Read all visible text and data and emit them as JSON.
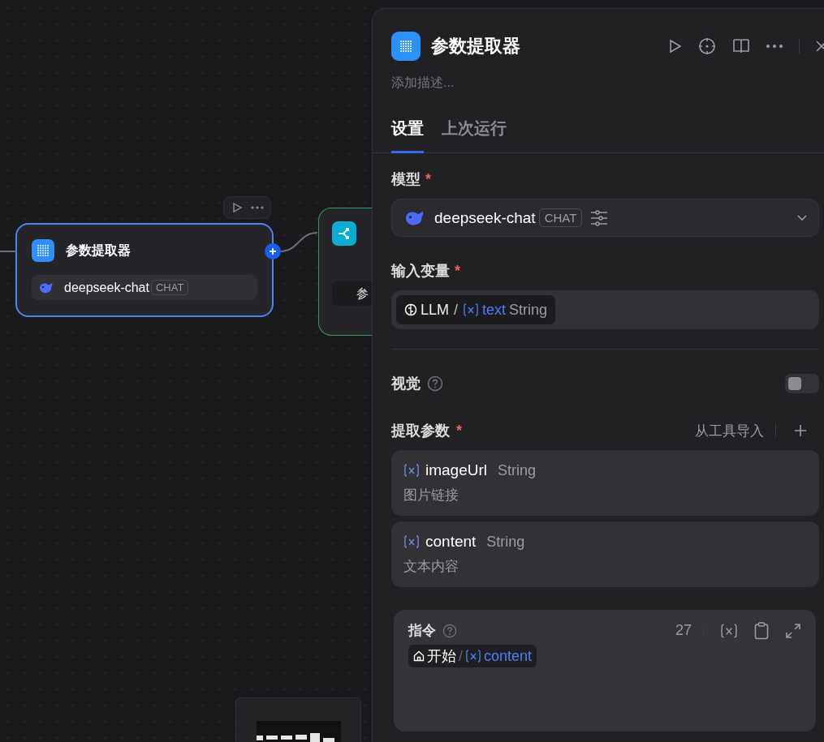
{
  "canvas": {
    "nodes": [
      {
        "kind": "extractor",
        "title": "参数提取器",
        "selected": true,
        "model": "deepseek-chat",
        "model_tag": "CHAT"
      },
      {
        "kind": "branch",
        "chip": "参",
        "selected": false
      }
    ]
  },
  "panel": {
    "title": "参数提取器",
    "description_placeholder": "添加描述...",
    "tabs": [
      {
        "label": "设置",
        "selected": true
      },
      {
        "label": "上次运行",
        "selected": false
      }
    ],
    "model": {
      "label": "模型",
      "required_mark": "*",
      "name": "deepseek-chat",
      "tag": "CHAT"
    },
    "input": {
      "label": "输入变量",
      "required_mark": "*",
      "source": "LLM",
      "separator": "/",
      "variable": "text",
      "type": "String"
    },
    "vision": {
      "label": "视觉",
      "on": false
    },
    "params": {
      "label": "提取参数",
      "required_mark": "*",
      "import_label": "从工具导入",
      "items": [
        {
          "name": "imageUrl",
          "type": "String",
          "description": "图片链接"
        },
        {
          "name": "content",
          "type": "String",
          "description": "文本内容"
        }
      ]
    },
    "instruction": {
      "label": "指令",
      "count": "27",
      "source": "开始",
      "separator": "/",
      "variable": "content"
    }
  }
}
